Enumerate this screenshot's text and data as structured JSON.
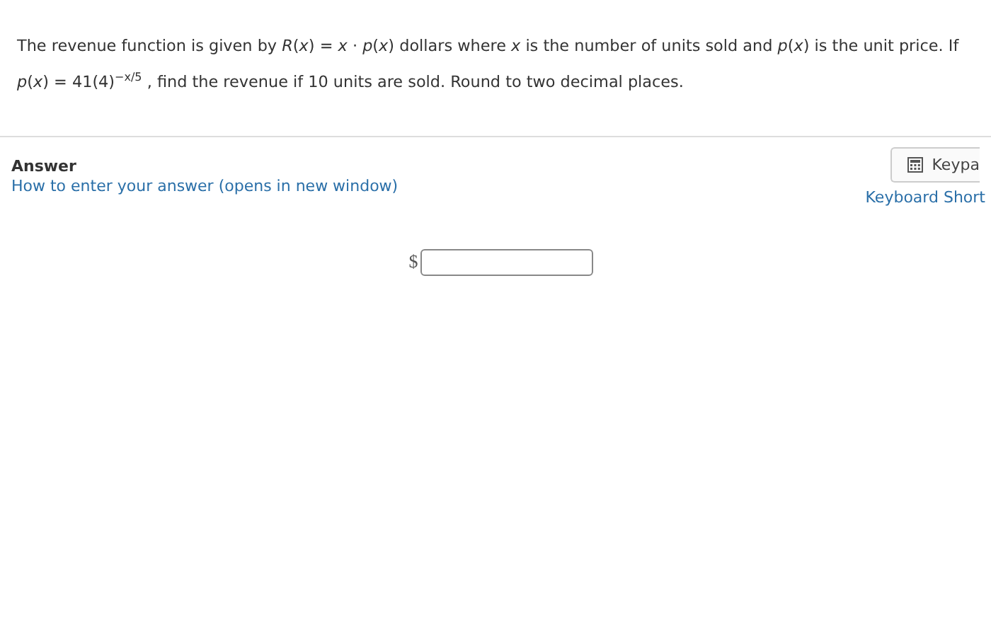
{
  "question": {
    "text": "The revenue function is given by *R*(*x*) = *x* · *p*(*x*) dollars where *x* is the number of units sold and *p*(*x*) is the unit price.  If *p*(*x*) = 41(4)$^{−x/5}$ , find the revenue if 10 units are sold.  Round to two decimal places."
  },
  "answer": {
    "heading": "Answer",
    "help_link": "How to enter your answer (opens in new window)",
    "keypad_button": "Keypa",
    "shortcuts_link": "Keyboard Short",
    "currency": "$"
  }
}
